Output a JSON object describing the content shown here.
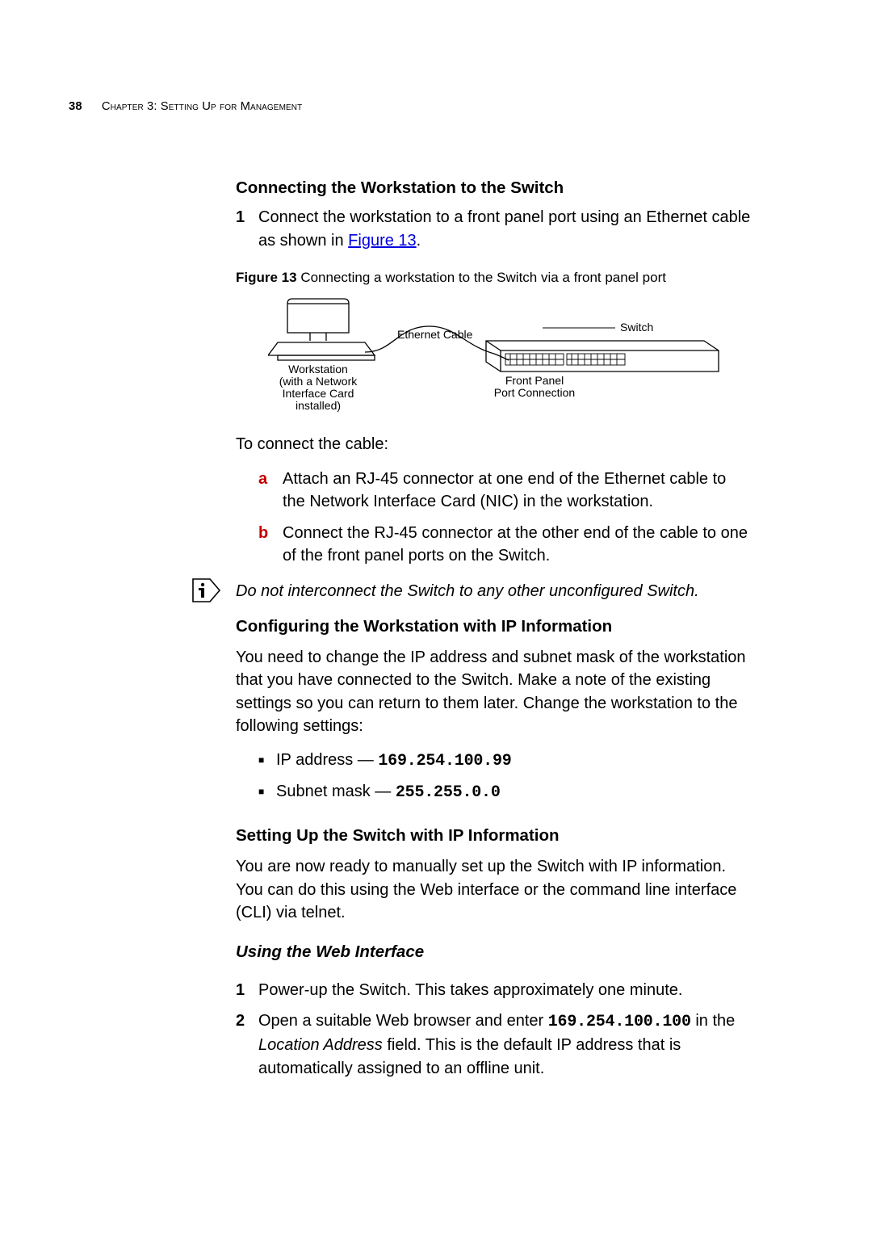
{
  "header": {
    "page_num": "38",
    "chapter": "Chapter 3: Setting Up for Management"
  },
  "s1": {
    "title": "Connecting the Workstation to the Switch",
    "step1_num": "1",
    "step1_text_a": "Connect the workstation to a front panel port using an Ethernet cable as shown in ",
    "step1_link": "Figure 13",
    "step1_text_b": ".",
    "fig_caption_label": "Figure 13",
    "fig_caption_text": "   Connecting a workstation to the Switch via a front panel port",
    "diagram": {
      "ethernet_cable": "Ethernet Cable",
      "switch": "Switch",
      "workstation_l1": "Workstation",
      "workstation_l2": "(with a Network",
      "workstation_l3": "Interface Card",
      "workstation_l4": "installed)",
      "front_panel_l1": "Front Panel",
      "front_panel_l2": "Port Connection"
    },
    "connect_intro": "To connect the cable:",
    "a_letter": "a",
    "a_text": "Attach an RJ-45 connector at one end of the Ethernet cable to the Network Interface Card (NIC) in the workstation.",
    "b_letter": "b",
    "b_text": "Connect the RJ-45 connector at the other end of the cable to one of the front panel ports on the Switch.",
    "note": "Do not interconnect the Switch to any other unconfigured Switch."
  },
  "s2": {
    "title": "Configuring the Workstation with IP Information",
    "para": "You need to change the IP address and subnet mask of the workstation that you have connected to the Switch. Make a note of the existing settings so you can return to them later. Change the workstation to the following settings:",
    "ip_label": "IP address — ",
    "ip_value": "169.254.100.99",
    "mask_label": "Subnet mask — ",
    "mask_value": "255.255.0.0"
  },
  "s3": {
    "title": "Setting Up the Switch with IP Information",
    "para": "You are now ready to manually set up the Switch with IP information. You can do this using the Web interface or the command line interface (CLI) via telnet."
  },
  "s4": {
    "title": "Using the Web Interface",
    "step1_num": "1",
    "step1_text": "Power-up the Switch. This takes approximately one minute.",
    "step2_num": "2",
    "step2_text_a": "Open a suitable Web browser and enter ",
    "step2_ip": "169.254.100.100",
    "step2_text_b": " in the ",
    "step2_field": "Location Address",
    "step2_text_c": " field. This is the default IP address that is automatically assigned to an offline unit."
  }
}
